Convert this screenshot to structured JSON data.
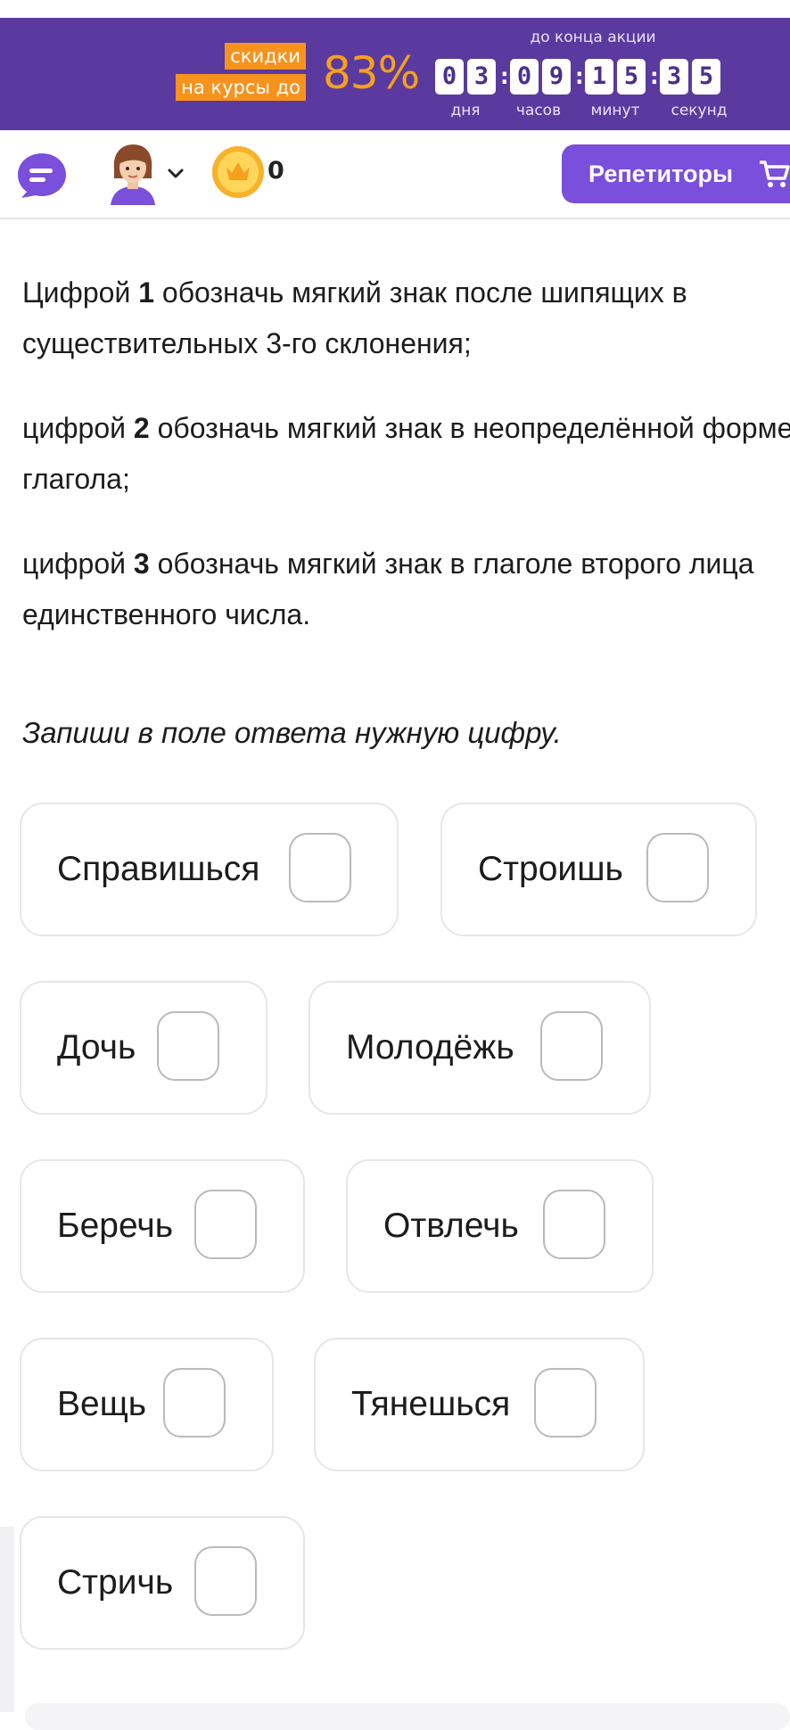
{
  "promo": {
    "tag_line1": "скидки",
    "tag_line2": "на курсы до",
    "percent": "83%",
    "caption": "до конца акции",
    "timer": {
      "days": [
        "0",
        "3"
      ],
      "hours": [
        "0",
        "9"
      ],
      "minutes": [
        "1",
        "5"
      ],
      "seconds": [
        "3",
        "5"
      ],
      "separator": ":"
    },
    "units": {
      "days": "дня",
      "hours": "часов",
      "minutes": "минут",
      "seconds": "секунд"
    },
    "colors": {
      "banner": "#5a3a9e",
      "tag": "#f7931d",
      "percent": "#f7a01e"
    }
  },
  "topbar": {
    "chat_icon": "chat-bubble-icon",
    "avatar": "student-avatar",
    "coins": "0",
    "tutors_button": "Репетиторы",
    "cart_icon": "cart-icon",
    "accent": "#7a4fdb"
  },
  "instructions": [
    {
      "prefix": "Цифрой ",
      "number": "1",
      "text": " обозначь мягкий знак после шипящих в существительных 3-го склонения;"
    },
    {
      "prefix": "цифрой ",
      "number": "2",
      "text": " обозначь мягкий знак в неопределённой форме глагола;"
    },
    {
      "prefix": "цифрой ",
      "number": "3",
      "text": " обозначь мягкий знак в глаголе второго лица единственного числа."
    }
  ],
  "hint": "Запиши в поле ответа нужную цифру.",
  "words": [
    {
      "word": "Справишься",
      "answer": ""
    },
    {
      "word": "Строишь",
      "answer": ""
    },
    {
      "word": "Дочь",
      "answer": ""
    },
    {
      "word": "Молодёжь",
      "answer": ""
    },
    {
      "word": "Беречь",
      "answer": ""
    },
    {
      "word": "Отвлечь",
      "answer": ""
    },
    {
      "word": "Вещь",
      "answer": ""
    },
    {
      "word": "Тянешься",
      "answer": ""
    },
    {
      "word": "Стричь",
      "answer": ""
    }
  ]
}
